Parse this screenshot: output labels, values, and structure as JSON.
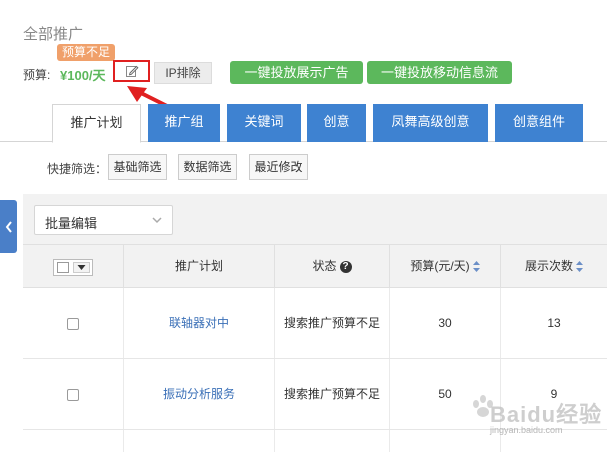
{
  "header": {
    "title": "全部推广",
    "budget_tip": "预算不足",
    "budget_label": "预算:",
    "budget_value": "¥100/天",
    "ip_exclude": "IP排除",
    "one_click_display": "一键投放展示广告",
    "one_click_mobile": "一键投放移动信息流"
  },
  "tabs": [
    {
      "label": "推广计划",
      "active": true
    },
    {
      "label": "推广组",
      "active": false
    },
    {
      "label": "关键词",
      "active": false
    },
    {
      "label": "创意",
      "active": false
    },
    {
      "label": "凤舞高级创意",
      "active": false
    },
    {
      "label": "创意组件",
      "active": false
    }
  ],
  "filters": {
    "label": "快捷筛选：",
    "basic": "基础筛选",
    "data": "数据筛选",
    "recent": "最近修改"
  },
  "toolbar": {
    "batch_edit": "批量编辑"
  },
  "table": {
    "columns": {
      "plan": "推广计划",
      "status": "状态",
      "budget": "预算(元/天)",
      "impressions": "展示次数"
    },
    "rows": [
      {
        "plan": "联轴器对中",
        "status": "搜索推广预算不足",
        "budget": "30",
        "impressions": "13"
      },
      {
        "plan": "振动分析服务",
        "status": "搜索推广预算不足",
        "budget": "50",
        "impressions": "9"
      }
    ]
  },
  "watermark": {
    "brand": "Baidu经验",
    "url": "jingyan.baidu.com"
  },
  "colors": {
    "tab_blue": "#3e82d1",
    "green": "#5cb85c",
    "tip_orange": "#f0a06a",
    "highlight_red": "#e02020"
  }
}
